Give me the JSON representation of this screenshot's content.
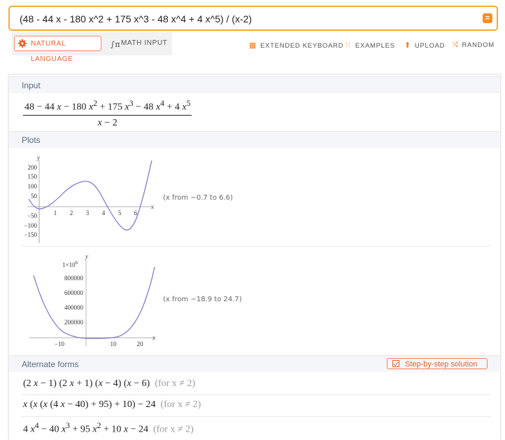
{
  "search": {
    "query": "(48 - 44 x - 180 x^2 + 175 x^3 - 48 x^4 + 4 x^5) / (x-2)",
    "go_icon": "="
  },
  "modes": {
    "natural": "NATURAL LANGUAGE",
    "math": "MATH INPUT"
  },
  "tools": {
    "keyboard": "EXTENDED KEYBOARD",
    "examples": "EXAMPLES",
    "upload": "UPLOAD",
    "random": "RANDOM"
  },
  "pods": {
    "input_title": "Input",
    "plots_title": "Plots",
    "alt_title": "Alternate forms",
    "step_button": "Step-by-step solution"
  },
  "plot1": {
    "range": "(x from −0.7 to 6.6)",
    "yticks": [
      "200",
      "150",
      "100",
      "50",
      "−50",
      "−100",
      "−150"
    ],
    "xticks": [
      "1",
      "2",
      "3",
      "4",
      "5",
      "6"
    ],
    "xlabel": "x",
    "ylabel": "y"
  },
  "plot2": {
    "range": "(x from −18.9 to 24.7)",
    "yticks": [
      "800000",
      "600000",
      "400000",
      "200000"
    ],
    "ytop": "1×10",
    "ytop_exp": "6",
    "xticks": [
      "−10",
      "10",
      "20"
    ],
    "xlabel": "x",
    "ylabel": "y"
  },
  "alt": {
    "cond": "(for x ≠ 2)"
  },
  "colors": {
    "accent": "#f7a935",
    "curve": "#7b71c7",
    "orange": "#e8612c"
  }
}
